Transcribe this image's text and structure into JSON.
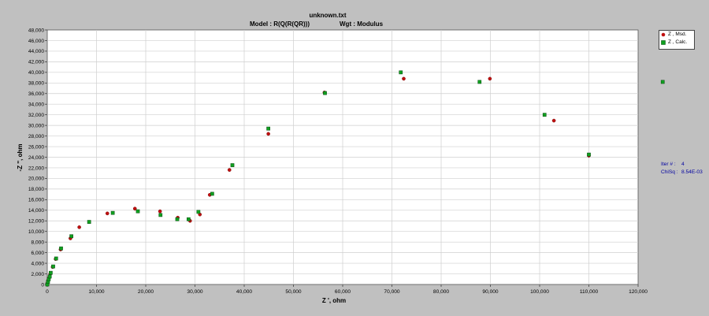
{
  "title": "unknown.txt",
  "subtitle_model": "Model : R(Q(R(QR)))",
  "subtitle_wgt": "Wgt : Modulus",
  "legend": [
    {
      "label": "Z , Msd.",
      "color": "#c01010",
      "marker": "circle"
    },
    {
      "label": "Z , Calc.",
      "color": "#10a020",
      "marker": "square"
    }
  ],
  "info": {
    "iter_label": "Iter # :",
    "iter_value": "4",
    "chisq_label": "ChiSq :",
    "chisq_value": "8.54E-03"
  },
  "chart_data": {
    "type": "scatter",
    "title": "unknown.txt",
    "xlabel": "Z ', ohm",
    "ylabel": "-Z '', ohm",
    "xlim": [
      0,
      120000
    ],
    "ylim": [
      0,
      48000
    ],
    "grid": true,
    "legend_position": "right",
    "x_ticks": [
      "0",
      "10,000",
      "20,000",
      "30,000",
      "40,000",
      "50,000",
      "60,000",
      "70,000",
      "80,000",
      "90,000",
      "100,000",
      "110,000",
      "120,000"
    ],
    "y_ticks": [
      "0",
      "2,000",
      "4,000",
      "6,000",
      "8,000",
      "10,000",
      "12,000",
      "14,000",
      "16,000",
      "18,000",
      "20,000",
      "22,000",
      "24,000",
      "26,000",
      "28,000",
      "30,000",
      "32,000",
      "34,000",
      "36,000",
      "38,000",
      "40,000",
      "42,000",
      "44,000",
      "46,000",
      "48,000"
    ],
    "series": [
      {
        "name": "Z , Msd.",
        "color": "#c01010",
        "marker": "circle",
        "points": [
          [
            0,
            0
          ],
          [
            100,
            400
          ],
          [
            200,
            800
          ],
          [
            400,
            1300
          ],
          [
            600,
            2000
          ],
          [
            1100,
            3300
          ],
          [
            1700,
            4800
          ],
          [
            2700,
            6600
          ],
          [
            4700,
            8700
          ],
          [
            6500,
            10800
          ],
          [
            12200,
            13400
          ],
          [
            17800,
            14300
          ],
          [
            22900,
            13800
          ],
          [
            26500,
            12600
          ],
          [
            29000,
            12000
          ],
          [
            31000,
            13200
          ],
          [
            33000,
            16900
          ],
          [
            37000,
            21600
          ],
          [
            44900,
            28400
          ],
          [
            56300,
            36200
          ],
          [
            72400,
            38800
          ],
          [
            89900,
            38800
          ],
          [
            102900,
            30900
          ],
          [
            110000,
            24300
          ]
        ]
      },
      {
        "name": "Z , Calc.",
        "color": "#10a020",
        "marker": "square",
        "points": [
          [
            0,
            0
          ],
          [
            150,
            500
          ],
          [
            300,
            1000
          ],
          [
            500,
            1500
          ],
          [
            700,
            2200
          ],
          [
            1200,
            3400
          ],
          [
            1800,
            4900
          ],
          [
            2800,
            6800
          ],
          [
            4900,
            9100
          ],
          [
            8500,
            11800
          ],
          [
            13300,
            13500
          ],
          [
            18400,
            13800
          ],
          [
            23000,
            13100
          ],
          [
            26400,
            12300
          ],
          [
            28700,
            12300
          ],
          [
            30700,
            13700
          ],
          [
            33500,
            17100
          ],
          [
            37600,
            22500
          ],
          [
            44900,
            29400
          ],
          [
            56400,
            36100
          ],
          [
            71800,
            40000
          ],
          [
            87800,
            38200
          ],
          [
            101000,
            32000
          ],
          [
            110000,
            24500
          ],
          [
            125000,
            38200
          ]
        ]
      }
    ]
  }
}
